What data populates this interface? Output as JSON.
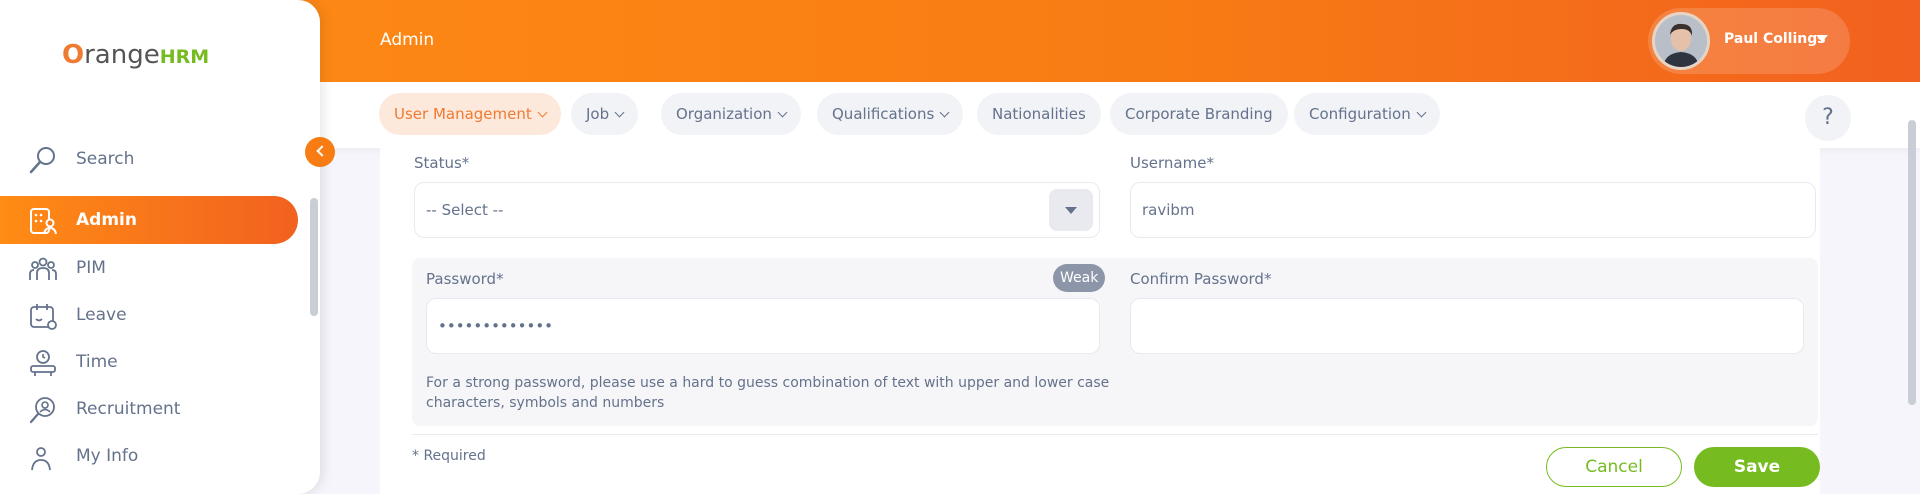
{
  "header": {
    "page_title": "Admin",
    "user_name": "Paul Collings"
  },
  "sidebar": {
    "logo_prefix": "O",
    "logo_main": "range",
    "logo_suffix": "HRM",
    "items": [
      {
        "label": "Search",
        "icon": "search-icon"
      },
      {
        "label": "Admin",
        "icon": "admin-icon",
        "active": true
      },
      {
        "label": "PIM",
        "icon": "people-icon"
      },
      {
        "label": "Leave",
        "icon": "leave-icon"
      },
      {
        "label": "Time",
        "icon": "time-icon"
      },
      {
        "label": "Recruitment",
        "icon": "recruitment-icon"
      },
      {
        "label": "My Info",
        "icon": "myinfo-icon"
      }
    ]
  },
  "topmenu": {
    "tabs": [
      {
        "label": "User Management",
        "active": true
      },
      {
        "label": "Job"
      },
      {
        "label": "Organization"
      },
      {
        "label": "Qualifications"
      },
      {
        "label": "Nationalities"
      },
      {
        "label": "Corporate Branding"
      },
      {
        "label": "Configuration"
      }
    ],
    "help_label": "?"
  },
  "form": {
    "status_label": "Status*",
    "status_value": "-- Select --",
    "username_label": "Username*",
    "username_value": "ravibm",
    "password_label": "Password*",
    "password_value": "•••••••••••••",
    "strength_badge": "Weak",
    "confirm_password_label": "Confirm Password*",
    "confirm_password_value": "",
    "hint_line1": "For a strong password, please use a hard to guess combination of text with upper and lower case",
    "hint_line2": "characters, symbols and numbers",
    "required_note": "* Required",
    "cancel_label": "Cancel",
    "save_label": "Save"
  },
  "colors": {
    "brand_orange": "#f87c14",
    "brand_green": "#76bc21",
    "text": "#64728c"
  }
}
